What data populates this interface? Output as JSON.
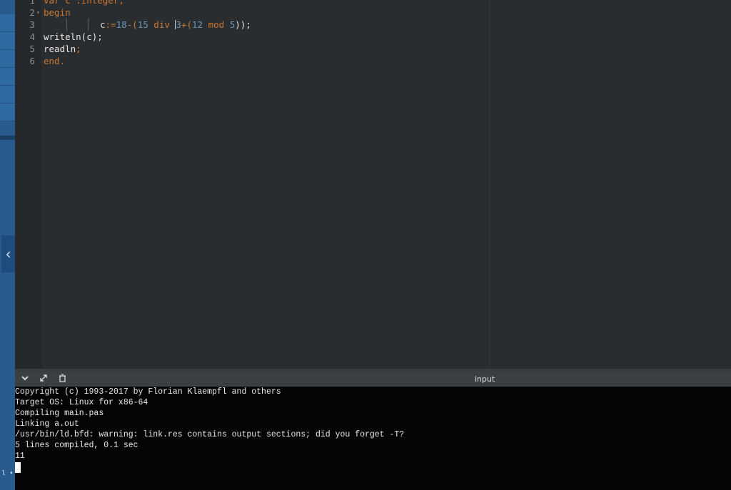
{
  "editor": {
    "lines": [
      {
        "n": "1",
        "fold": "",
        "parts": [
          {
            "t": "var c :integer;",
            "c": "kw"
          }
        ]
      },
      {
        "n": "2",
        "fold": "▾",
        "parts": [
          {
            "t": "begin",
            "c": "kw"
          }
        ]
      },
      {
        "n": "3",
        "fold": "",
        "guides": true,
        "parts": [
          {
            "t": "c",
            "c": "ident"
          },
          {
            "t": ":=",
            "c": "op"
          },
          {
            "t": "18",
            "c": "num"
          },
          {
            "t": "-(",
            "c": "op"
          },
          {
            "t": "15",
            "c": "num"
          },
          {
            "t": " div ",
            "c": "kw"
          },
          {
            "t": "|",
            "c": "cursor"
          },
          {
            "t": "3",
            "c": "num"
          },
          {
            "t": "+(",
            "c": "op"
          },
          {
            "t": "12",
            "c": "num"
          },
          {
            "t": " mod ",
            "c": "kw"
          },
          {
            "t": "5",
            "c": "num"
          },
          {
            "t": "));",
            "c": "fn"
          }
        ]
      },
      {
        "n": "4",
        "fold": "",
        "parts": [
          {
            "t": "writeln(c);",
            "c": "fn"
          }
        ]
      },
      {
        "n": "5",
        "fold": "",
        "parts": [
          {
            "t": "readln",
            "c": "fn"
          },
          {
            "t": ";",
            "c": "op"
          }
        ]
      },
      {
        "n": "6",
        "fold": "",
        "parts": [
          {
            "t": "end.",
            "c": "kw"
          }
        ]
      }
    ]
  },
  "panel": {
    "title": "input",
    "collapse_icon": "chevron-down-icon",
    "expand_icon": "expand-icon",
    "clear_icon": "clear-icon"
  },
  "terminal": {
    "lines": [
      "Copyright (c) 1993-2017 by Florian Klaempfl and others",
      "Target OS: Linux for x86-64",
      "Compiling main.pas",
      "Linking a.out",
      "/usr/bin/ld.bfd: warning: link.res contains output sections; did you forget -T?",
      "5 lines compiled, 0.1 sec",
      "11"
    ]
  },
  "sidebar": {
    "toggle_icon": "chevron-left-icon",
    "footer_text": "l •"
  },
  "colors": {
    "keyword": "#cc7832",
    "number": "#6897bb",
    "sidebar": "#2a5b8e",
    "terminal_bg": "#050505"
  }
}
